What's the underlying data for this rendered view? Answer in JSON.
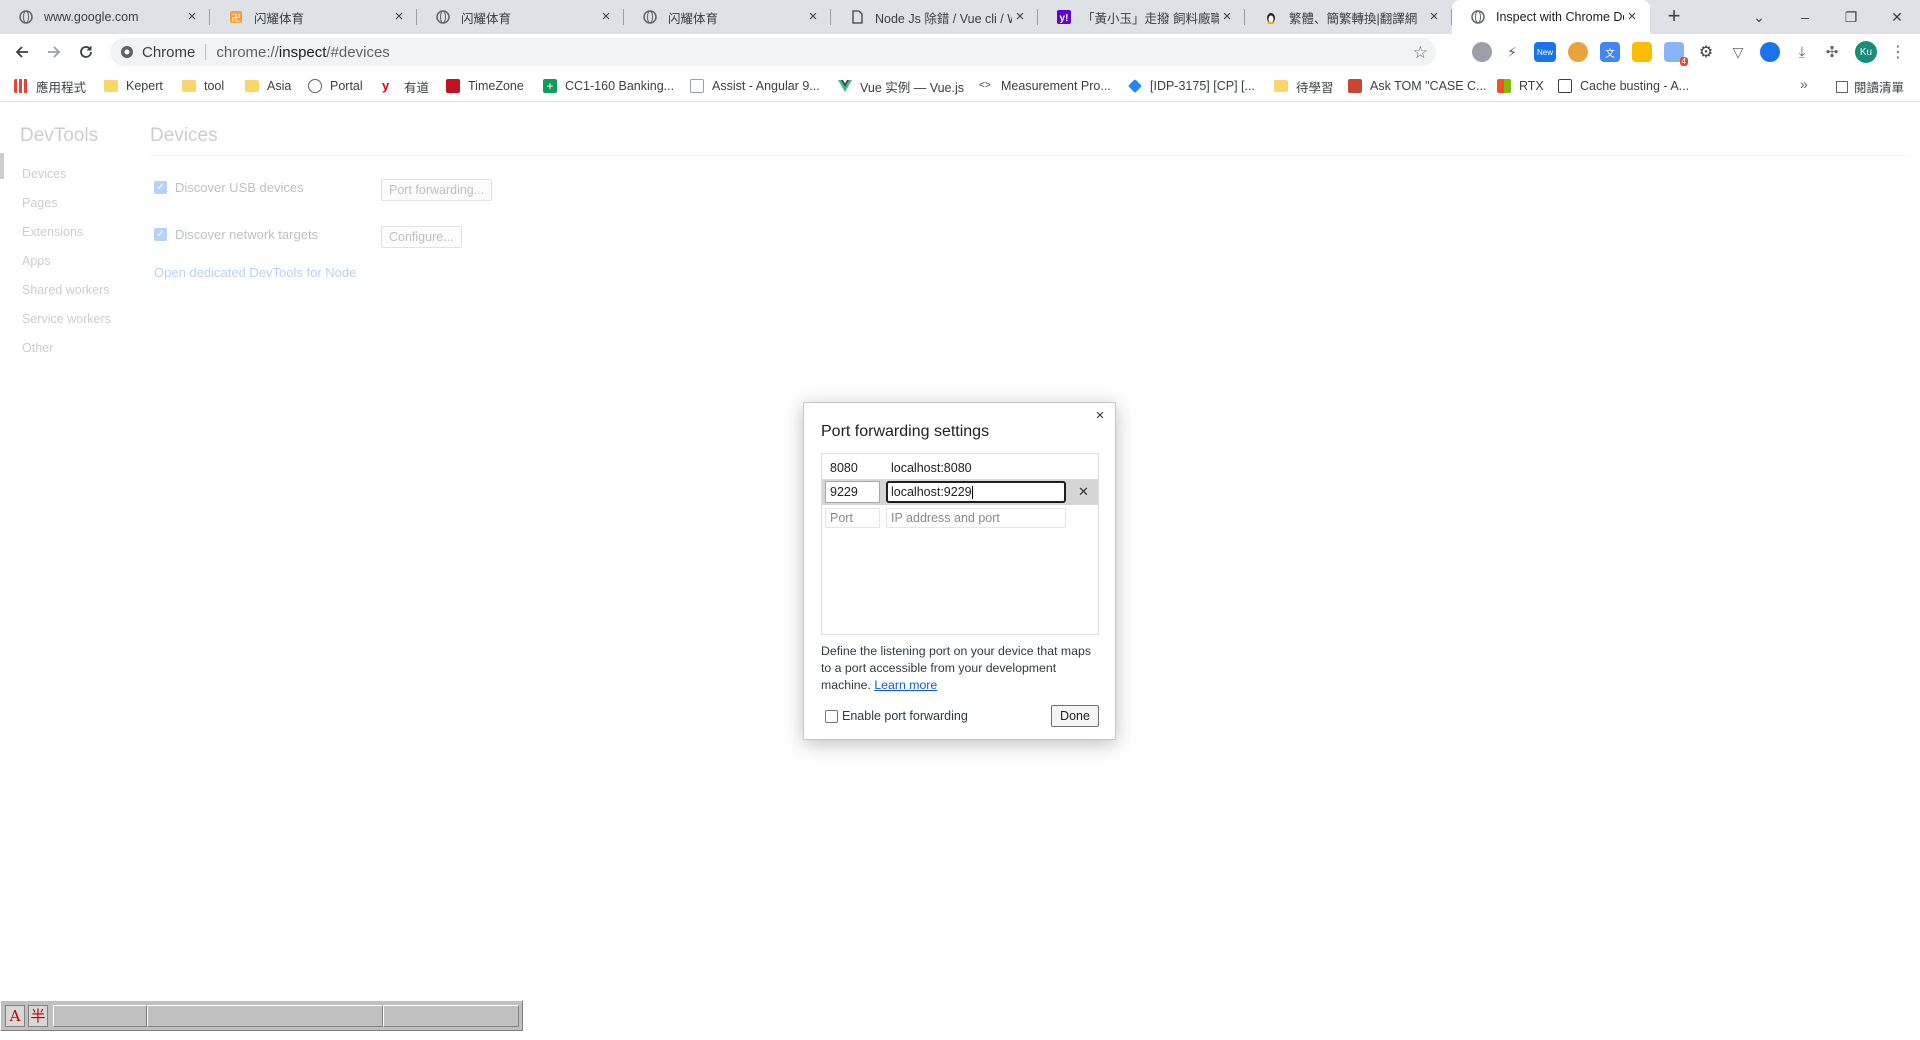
{
  "tabs": [
    {
      "title": "www.google.com",
      "icon": "globe-icon",
      "color": "#5f6368"
    },
    {
      "title": "闪耀体育",
      "icon": "orange-site-icon",
      "color": "#f4a33b"
    },
    {
      "title": "闪耀体育",
      "icon": "globe-icon",
      "color": "#5f6368"
    },
    {
      "title": "闪耀体育",
      "icon": "globe-icon",
      "color": "#5f6368"
    },
    {
      "title": "Node Js 除錯 / Vue cli / W",
      "icon": "document-icon",
      "color": "#3c4043"
    },
    {
      "title": "「黃小玉」走撥 飼料廠職",
      "icon": "yahoo-icon",
      "color": "#6001d2"
    },
    {
      "title": "繁體、簡繁轉換|翻譯網",
      "icon": "penguin-icon",
      "color": "#202124"
    },
    {
      "title": "Inspect with Chrome Dev",
      "icon": "globe-icon",
      "color": "#5f6368",
      "active": true
    }
  ],
  "window": {
    "minimize": "–",
    "restore": "❐",
    "close": "✕",
    "tab_search": "⌄",
    "new_tab": "+"
  },
  "omnibox": {
    "chip": "Chrome",
    "scheme": "chrome://",
    "host": "inspect",
    "path": "/#devices"
  },
  "extensions": {
    "new_badge": "New",
    "count_badge": "4",
    "profile_initials": "Ku"
  },
  "bookmarks": [
    {
      "label": "應用程式",
      "kind": "apps-icon",
      "color": "#1a73e8"
    },
    {
      "label": "Kepert",
      "kind": "folder-icon",
      "color": "#f9d66b"
    },
    {
      "label": "tool",
      "kind": "folder-icon",
      "color": "#f9d66b"
    },
    {
      "label": "Asia",
      "kind": "folder-icon",
      "color": "#f9d66b"
    },
    {
      "label": "Portal",
      "kind": "globe-icon",
      "color": "#5f6368"
    },
    {
      "label": "有道",
      "kind": "youdao-icon",
      "color": "#e3001b"
    },
    {
      "label": "TimeZone",
      "kind": "timezone-icon",
      "color": "#c1121f"
    },
    {
      "label": "CC1-160 Banking...",
      "kind": "plus-green-icon",
      "color": "#0f9d58"
    },
    {
      "label": "Assist - Angular 9...",
      "kind": "doc-icon",
      "color": "#9aa0a6"
    },
    {
      "label": "Vue 实例 — Vue.js",
      "kind": "vue-icon",
      "color": "#41b883"
    },
    {
      "label": "Measurement Pro...",
      "kind": "code-icon",
      "color": "#3c4043"
    },
    {
      "label": "[IDP-3175] [CP] [...",
      "kind": "jira-icon",
      "color": "#2684ff"
    },
    {
      "label": "待學習",
      "kind": "folder-icon",
      "color": "#f9d66b"
    },
    {
      "label": "Ask TOM \"CASE C...",
      "kind": "oracle-icon",
      "color": "#c74634"
    },
    {
      "label": "RTX",
      "kind": "ms-icon",
      "color": "#f25022"
    },
    {
      "label": "Cache busting - A...",
      "kind": "cache-icon",
      "color": "#3c4043"
    }
  ],
  "bookmarks_more": "»",
  "reading_list": "閱讀清單",
  "devtools": {
    "sidebar_title": "DevTools",
    "sidebar_items": [
      "Devices",
      "Pages",
      "Extensions",
      "Apps",
      "Shared workers",
      "Service workers",
      "Other"
    ],
    "main_title": "Devices",
    "discover_usb": "Discover USB devices",
    "port_forwarding_btn": "Port forwarding...",
    "discover_network": "Discover network targets",
    "configure_btn": "Configure...",
    "node_link": "Open dedicated DevTools for Node"
  },
  "dialog": {
    "title": "Port forwarding settings",
    "close": "×",
    "rules": [
      {
        "port": "8080",
        "address": "localhost:8080"
      },
      {
        "port": "9229",
        "address": "localhost:9229"
      }
    ],
    "placeholder_port": "Port",
    "placeholder_address": "IP address and port",
    "delete": "✕",
    "description": "Define the listening port on your device that maps to a port accessible from your development machine.",
    "learn_more": "Learn more",
    "enable_label": "Enable port forwarding",
    "done": "Done"
  },
  "ime": {
    "key_a": "A",
    "key_half": "半"
  }
}
